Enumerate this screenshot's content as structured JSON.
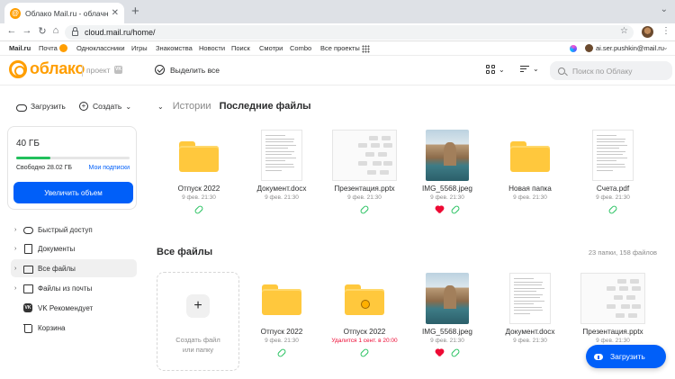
{
  "browser": {
    "tab_title": "Облако Mail.ru - облачное хр",
    "url": "cloud.mail.ru/home/",
    "favicon_letter": "@"
  },
  "portal": {
    "logo": "Mail.ru",
    "items": [
      "Почта",
      "Одноклассники",
      "Игры",
      "Знакомства",
      "Новости",
      "Поиск",
      "Смотри",
      "Combo",
      "Все проекты"
    ],
    "user_email": "ai.ser.pushkin@mail.ru"
  },
  "header": {
    "logo_text": "облако",
    "logo_sub": "проект",
    "logo_vk": "VK",
    "select_all": "Выделить все",
    "search_placeholder": "Поиск по Облаку"
  },
  "sidebar": {
    "upload": "Загрузить",
    "create": "Создать",
    "storage_total": "40 ГБ",
    "storage_free": "Свободно 28.02 ГБ",
    "storage_used_fraction": 0.3,
    "subscriptions": "Мои подписки",
    "increase_button": "Увеличить объем",
    "items": [
      {
        "label": "Быстрый доступ",
        "expandable": true,
        "icon": "cloud-icon"
      },
      {
        "label": "Документы",
        "expandable": true,
        "icon": "document-icon"
      },
      {
        "label": "Все файлы",
        "expandable": true,
        "icon": "folder-icon",
        "active": true
      },
      {
        "label": "Файлы из почты",
        "expandable": true,
        "icon": "mail-icon"
      },
      {
        "label": "VK Рекомендует",
        "expandable": false,
        "icon": "vk-icon"
      },
      {
        "label": "Корзина",
        "expandable": false,
        "icon": "trash-icon"
      }
    ]
  },
  "recent": {
    "tab_stories": "Истории",
    "tab_recent": "Последние файлы",
    "files": [
      {
        "name": "Отпуск 2022",
        "date": "9 фев. 21:30",
        "kind": "folder",
        "shared": true,
        "favorite": false
      },
      {
        "name": "Документ.docx",
        "date": "9 фев. 21:30",
        "kind": "doc",
        "shared": false,
        "favorite": false
      },
      {
        "name": "Презентация.pptx",
        "date": "9 фев. 21:30",
        "kind": "ppt",
        "shared": true,
        "favorite": false
      },
      {
        "name": "IMG_5568.jpeg",
        "date": "9 фев. 21:30",
        "kind": "image",
        "shared": true,
        "favorite": true
      },
      {
        "name": "Новая папка",
        "date": "9 фев. 21:30",
        "kind": "folder",
        "shared": false,
        "favorite": false
      },
      {
        "name": "Счета.pdf",
        "date": "9 фев. 21:30",
        "kind": "pdf",
        "shared": true,
        "favorite": false
      }
    ]
  },
  "all_files": {
    "title": "Все файлы",
    "count": "23 папки, 158 файлов",
    "create_tile": "Создать файл или папку",
    "files": [
      {
        "name": "Отпуск 2022",
        "date": "9 фев. 21:30",
        "kind": "folder",
        "shared": true,
        "favorite": false
      },
      {
        "name": "Отпуск 2022",
        "date": "Удалится 1 сент. в 20:00",
        "kind": "folder-shared",
        "shared": true,
        "favorite": false,
        "warn": true
      },
      {
        "name": "IMG_5568.jpeg",
        "date": "9 фев. 21:30",
        "kind": "image",
        "shared": true,
        "favorite": true
      },
      {
        "name": "Документ.docx",
        "date": "9 фев. 21:30",
        "kind": "doc",
        "shared": false,
        "favorite": false
      },
      {
        "name": "Презентация.pptx",
        "date": "9 фев. 21:30",
        "kind": "ppt",
        "shared": false,
        "favorite": false
      }
    ]
  },
  "fab": {
    "label": "Загрузить"
  },
  "colors": {
    "accent": "#005ff9",
    "brand": "#ff9e00",
    "success": "#22c05c",
    "danger": "#ed0a34"
  }
}
